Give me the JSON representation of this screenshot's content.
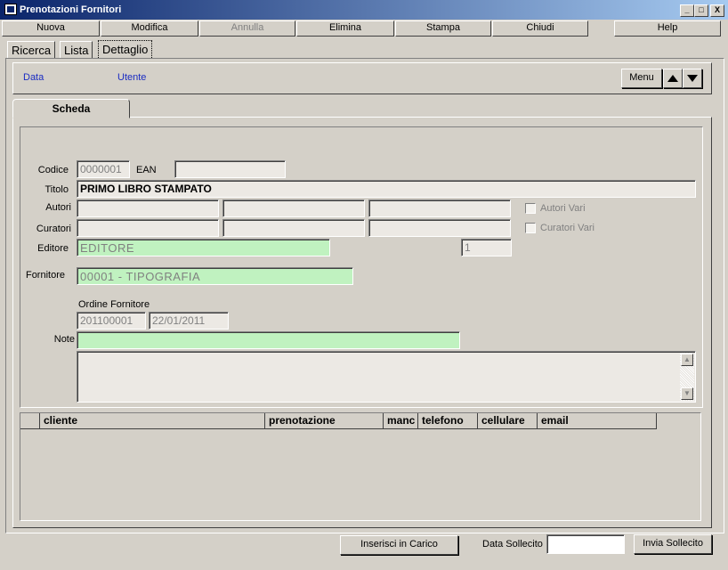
{
  "window": {
    "title": "Prenotazioni Fornitori",
    "minimize": "_",
    "maximize": "□",
    "close": "X"
  },
  "toolbar": {
    "nuova": "Nuova",
    "modifica": "Modifica",
    "annulla": "Annulla",
    "elimina": "Elimina",
    "stampa": "Stampa",
    "chiudi": "Chiudi",
    "help": "Help"
  },
  "tabs": {
    "ricerca": "Ricerca",
    "lista": "Lista",
    "dettaglio": "Dettaglio"
  },
  "info": {
    "data": "Data",
    "utente": "Utente",
    "menu": "Menu"
  },
  "scheda_tab": "Scheda",
  "form": {
    "codice_label": "Codice",
    "codice": "0000001",
    "ean_label": "EAN",
    "ean": "",
    "titolo_label": "Titolo",
    "titolo": "PRIMO LIBRO STAMPATO",
    "autori_label": "Autori",
    "autori_vari": "Autori Vari",
    "curatori_label": "Curatori",
    "curatori_vari": "Curatori Vari",
    "editore_label": "Editore",
    "editore": "EDITORE",
    "editore_num": "1",
    "fornitore_label": "Fornitore",
    "fornitore": "00001 - TIPOGRAFIA",
    "ordine_label": "Ordine Fornitore",
    "ordine_num": "201100001",
    "ordine_data": "22/01/2011",
    "note_label": "Note",
    "note": ""
  },
  "grid": {
    "columns": [
      "cliente",
      "prenotazione",
      "manc",
      "telefono",
      "cellulare",
      "email"
    ]
  },
  "footer": {
    "inserisci": "Inserisci in Carico",
    "data_sollecito_label": "Data Sollecito",
    "data_sollecito": "",
    "invia": "Invia Sollecito"
  },
  "colors": {
    "title_bar": "#0a246a",
    "window_bg": "#d4d0c8",
    "field_green": "#c0f2c0",
    "label_blue": "#1a2cc2"
  }
}
